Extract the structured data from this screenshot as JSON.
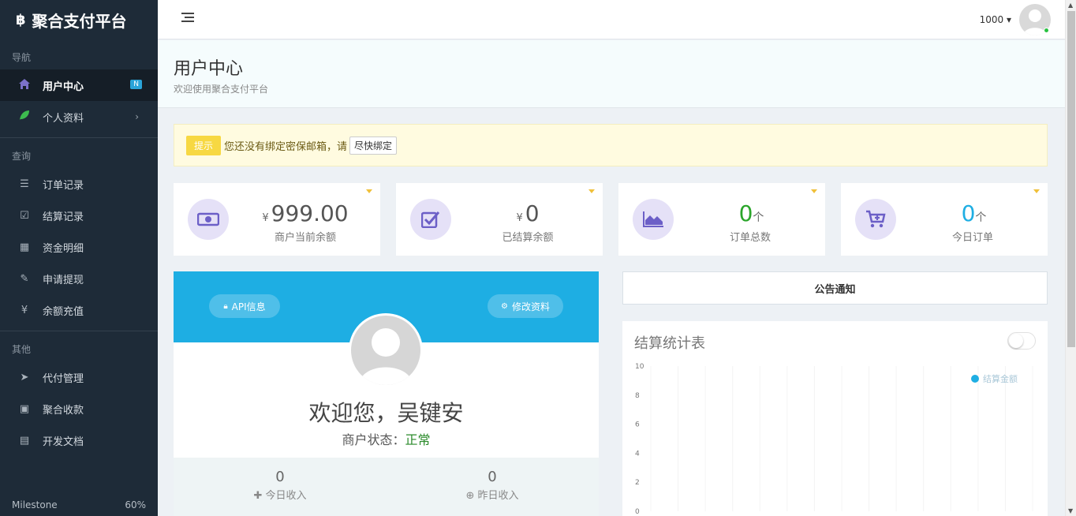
{
  "brand": {
    "icon": "฿",
    "name": "聚合支付平台"
  },
  "sidebar": {
    "sections": [
      {
        "heading": "导航",
        "items": [
          {
            "label": "用户中心",
            "icon": "home-icon",
            "badge": "N",
            "active": true
          },
          {
            "label": "个人资料",
            "icon": "leaf-icon",
            "chevron": "›"
          }
        ]
      },
      {
        "heading": "查询",
        "items": [
          {
            "label": "订单记录",
            "icon": "list-icon"
          },
          {
            "label": "结算记录",
            "icon": "check-square-icon"
          },
          {
            "label": "资金明细",
            "icon": "grid-icon"
          },
          {
            "label": "申请提现",
            "icon": "edit-check-icon"
          },
          {
            "label": "余额充值",
            "icon": "yen-icon"
          }
        ]
      },
      {
        "heading": "其他",
        "items": [
          {
            "label": "代付管理",
            "icon": "send-icon"
          },
          {
            "label": "聚合收款",
            "icon": "qrcode-icon"
          },
          {
            "label": "开发文档",
            "icon": "book-icon"
          }
        ]
      }
    ],
    "milestone": {
      "label": "Milestone",
      "value": "60%"
    }
  },
  "topbar": {
    "user": "1000",
    "caret": "▾"
  },
  "header": {
    "title": "用户中心",
    "subtitle": "欢迎使用聚合支付平台"
  },
  "alert": {
    "tag": "提示",
    "text": "您还没有绑定密保邮箱，请",
    "button": "尽快绑定"
  },
  "stats": [
    {
      "icon": "money-icon",
      "currency": "¥",
      "value": "999.00",
      "unit": "",
      "label": "商户当前余额",
      "color": "#555"
    },
    {
      "icon": "checkbox-icon",
      "currency": "¥",
      "value": "0",
      "unit": "",
      "label": "已结算余额",
      "color": "#555"
    },
    {
      "icon": "area-chart-icon",
      "currency": "",
      "value": "0",
      "unit": "个",
      "label": "订单总数",
      "color": "#2aa52a"
    },
    {
      "icon": "cart-plus-icon",
      "currency": "",
      "value": "0",
      "unit": "个",
      "label": "今日订单",
      "color": "#1eaee3"
    }
  ],
  "profile": {
    "api_button": "API信息",
    "edit_button": "修改资料",
    "welcome": "欢迎您，吴键安",
    "status_label": "商户状态：",
    "status_value": "正常",
    "income": [
      {
        "value": "0",
        "label": "今日收入",
        "icon": "plus-icon"
      },
      {
        "value": "0",
        "label": "昨日收入",
        "icon": "plus-circle-icon"
      }
    ]
  },
  "notice": {
    "title": "公告通知"
  },
  "chart_data": {
    "type": "line",
    "title": "结算统计表",
    "ylim": [
      0,
      10
    ],
    "yticks": [
      0,
      2,
      4,
      6,
      8,
      10
    ],
    "series": [
      {
        "name": "结算金额",
        "values": [],
        "color": "#1eaee3"
      }
    ],
    "legend": "top-right",
    "grid": true
  }
}
